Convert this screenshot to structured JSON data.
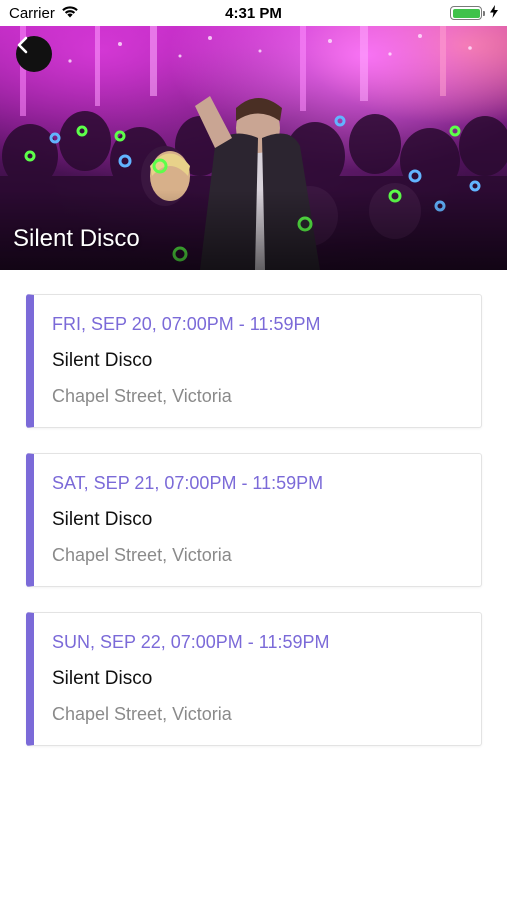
{
  "status_bar": {
    "carrier": "Carrier",
    "time": "4:31 PM",
    "wifi_icon": "wifi-icon",
    "battery_level": 1.0,
    "battery_color": "#3fc24a",
    "charging_icon": "bolt-icon"
  },
  "header": {
    "title": "Silent Disco",
    "back_icon": "chevron-left-icon",
    "image": "party-crowd-photo"
  },
  "colors": {
    "accent": "#7b6ad8",
    "location_text": "#8a8a8a"
  },
  "events": [
    {
      "date": "FRI, SEP 20, 07:00PM - 11:59PM",
      "name": "Silent Disco",
      "location": "Chapel Street, Victoria"
    },
    {
      "date": "SAT, SEP 21, 07:00PM - 11:59PM",
      "name": "Silent Disco",
      "location": "Chapel Street, Victoria"
    },
    {
      "date": "SUN, SEP 22, 07:00PM - 11:59PM",
      "name": "Silent Disco",
      "location": "Chapel Street, Victoria"
    }
  ]
}
